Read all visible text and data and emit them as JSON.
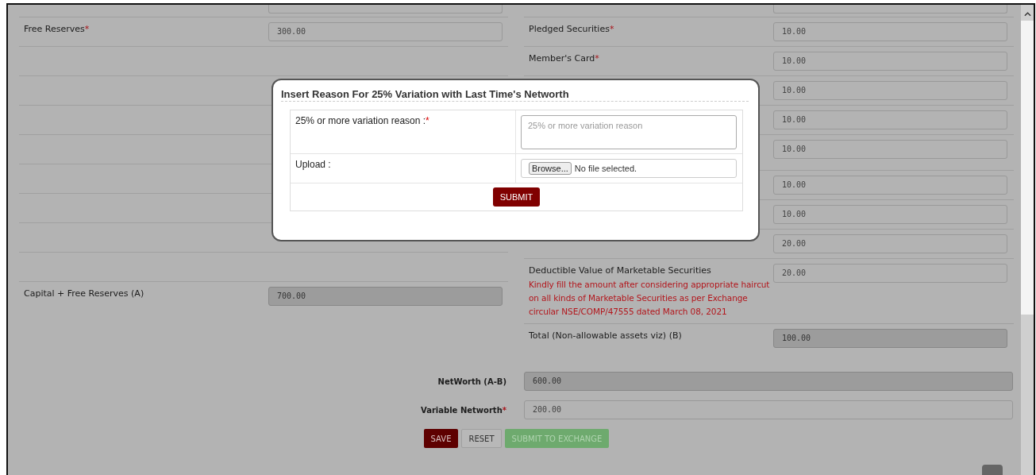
{
  "left_rows": [
    {
      "kind": "stub"
    },
    {
      "kind": "field",
      "label": "Free Reserves",
      "required_mark": "*",
      "value": "300.00",
      "readonly": false
    },
    {
      "kind": "blank"
    },
    {
      "kind": "blank"
    },
    {
      "kind": "blank"
    },
    {
      "kind": "blank"
    },
    {
      "kind": "blank"
    },
    {
      "kind": "blank"
    },
    {
      "kind": "blank"
    },
    {
      "kind": "blank"
    },
    {
      "kind": "field",
      "label": "Capital + Free Reserves (A)",
      "value": "700.00",
      "readonly": true
    }
  ],
  "right_rows": [
    {
      "kind": "stub"
    },
    {
      "kind": "field",
      "label": "Pledged Securities",
      "required_mark": "*",
      "value": "10.00",
      "readonly": false
    },
    {
      "kind": "field",
      "label": "Member's Card",
      "required_mark": "*",
      "value": "10.00",
      "readonly": false
    },
    {
      "kind": "field",
      "value": "10.00",
      "readonly": false
    },
    {
      "kind": "field",
      "value": "10.00",
      "readonly": false
    },
    {
      "kind": "field",
      "value": "10.00",
      "readonly": false,
      "tall": true
    },
    {
      "kind": "field",
      "value": "10.00",
      "readonly": false
    },
    {
      "kind": "field",
      "value": "10.00",
      "readonly": false
    },
    {
      "kind": "field",
      "value": "20.00",
      "readonly": false
    },
    {
      "kind": "field",
      "label": "Deductible Value of Marketable Securities",
      "note": "Kindly fill the amount after considering appropriate haircut on all kinds of Marketable Securities as per Exchange circular NSE/COMP/47555 dated March 08, 2021",
      "value": "20.00",
      "readonly": false
    },
    {
      "kind": "field",
      "label": "Total (Non-allowable assets viz) (B)",
      "value": "100.00",
      "readonly": true
    }
  ],
  "totals": [
    {
      "label": "NetWorth (A-B)",
      "value": "600.00",
      "readonly": true
    },
    {
      "label": "Variable Networth",
      "required_mark": "*",
      "value": "200.00",
      "readonly": false
    }
  ],
  "buttons": [
    {
      "kind": "primary",
      "label": "SAVE",
      "disabled": false
    },
    {
      "kind": "default",
      "label": "RESET",
      "disabled": false
    },
    {
      "kind": "success",
      "label": "SUBMIT TO EXCHANGE",
      "disabled": true
    }
  ],
  "modal": {
    "title": "Insert Reason For 25% Variation with Last Time's Networth",
    "reason": {
      "label": "25% or more variation reason :",
      "required_mark": "*",
      "placeholder": "25% or more variation reason"
    },
    "upload": {
      "label": "Upload :",
      "button": "Browse...",
      "status": "No file selected."
    },
    "submit": "SUBMIT"
  }
}
